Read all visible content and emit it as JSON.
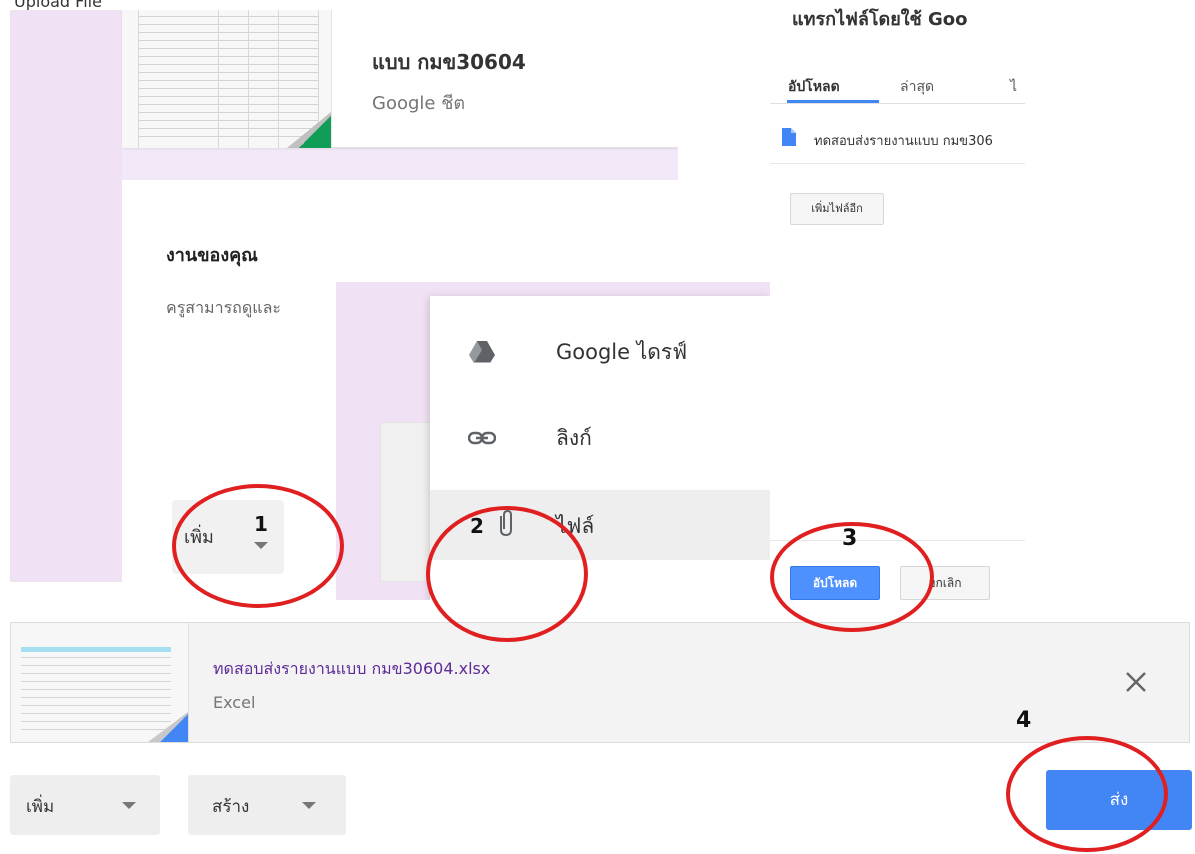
{
  "stub_text": "Upload File",
  "classroom": {
    "attachment_title": "แบบ กมข30604",
    "attachment_type": "Google ชีต",
    "work_title": "งานของคุณ",
    "work_desc": "ครูสามารถดูและ",
    "add_label": "เพิ่ม"
  },
  "menu": {
    "items": [
      {
        "label": "Google ไดรฟ์",
        "icon": "google-drive-icon"
      },
      {
        "label": "ลิงก์",
        "icon": "link-icon"
      },
      {
        "label": "ไฟล์",
        "icon": "paperclip-icon"
      }
    ]
  },
  "dialog": {
    "title": "แทรกไฟล์โดยใช้ Goo",
    "tabs": [
      "อัปโหลด",
      "ล่าสุด",
      "ไ"
    ],
    "file_name": "ทดสอบส่งรายงานแบบ กมข306",
    "add_more": "เพิ่มไฟล์อีก",
    "upload": "อัปโหลด",
    "cancel": "ยกเลิก"
  },
  "attachment": {
    "name": "ทดสอบส่งรายงานแบบ กมข30604.xlsx",
    "type": "Excel"
  },
  "toolbar": {
    "add": "เพิ่ม",
    "create": "สร้าง",
    "send": "ส่ง"
  },
  "steps": [
    "1",
    "2",
    "3",
    "4"
  ],
  "colors": {
    "accent_blue": "#4285f4",
    "annotation_red": "#e02020",
    "sheets_green": "#0f9d58",
    "panel_lavender": "#f1e1f4"
  }
}
